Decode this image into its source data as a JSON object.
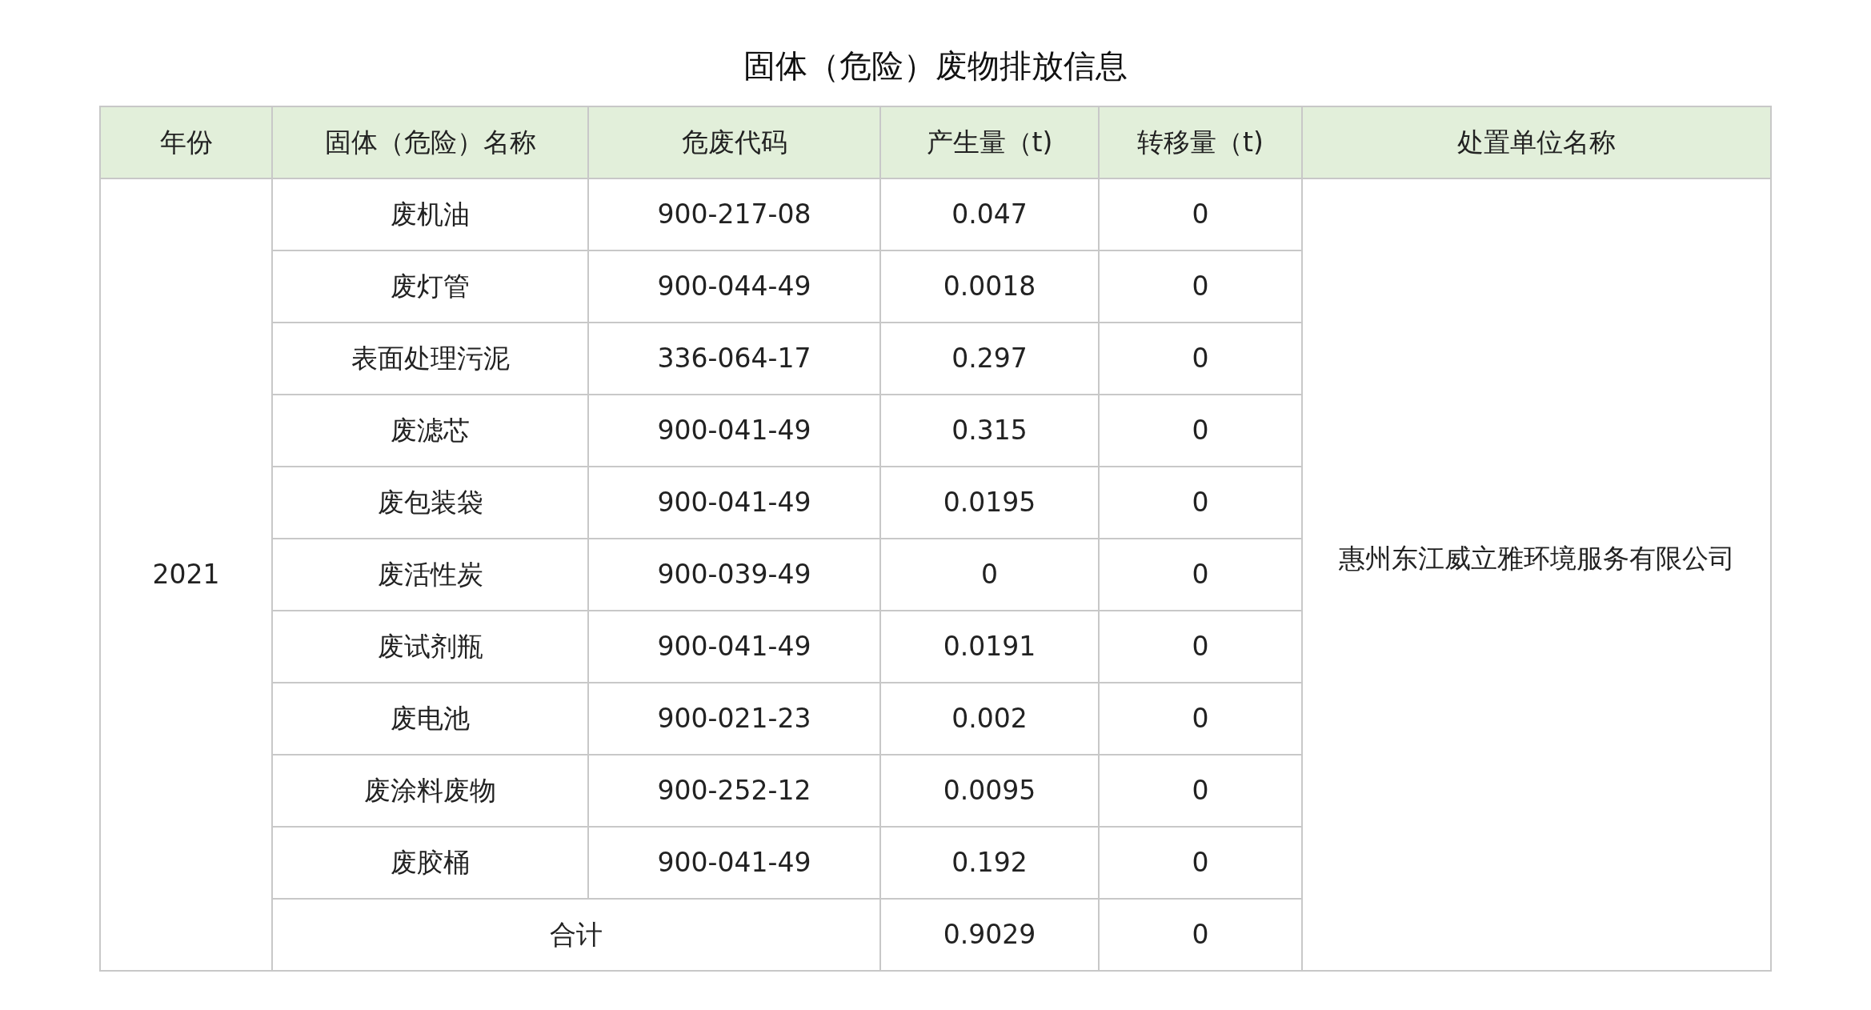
{
  "title": "固体（危险）废物排放信息",
  "columns": [
    "年份",
    "固体（危险）名称",
    "危废代码",
    "产生量（t)",
    "转移量（t)",
    "处置单位名称"
  ],
  "year": "2021",
  "disposal_unit": "惠州东江威立雅环境服务有限公司",
  "rows": [
    {
      "name": "废机油",
      "code": "900-217-08",
      "produced": "0.047",
      "transferred": "0"
    },
    {
      "name": "废灯管",
      "code": "900-044-49",
      "produced": "0.0018",
      "transferred": "0"
    },
    {
      "name": "表面处理污泥",
      "code": "336-064-17",
      "produced": "0.297",
      "transferred": "0"
    },
    {
      "name": "废滤芯",
      "code": "900-041-49",
      "produced": "0.315",
      "transferred": "0"
    },
    {
      "name": "废包装袋",
      "code": "900-041-49",
      "produced": "0.0195",
      "transferred": "0"
    },
    {
      "name": "废活性炭",
      "code": "900-039-49",
      "produced": "0",
      "transferred": "0"
    },
    {
      "name": "废试剂瓶",
      "code": "900-041-49",
      "produced": "0.0191",
      "transferred": "0"
    },
    {
      "name": "废电池",
      "code": "900-021-23",
      "produced": "0.002",
      "transferred": "0"
    },
    {
      "name": "废涂料废物",
      "code": "900-252-12",
      "produced": "0.0095",
      "transferred": "0"
    },
    {
      "name": "废胶桶",
      "code": "900-041-49",
      "produced": "0.192",
      "transferred": "0"
    }
  ],
  "total": {
    "label": "合计",
    "produced": "0.9029",
    "transferred": "0"
  }
}
